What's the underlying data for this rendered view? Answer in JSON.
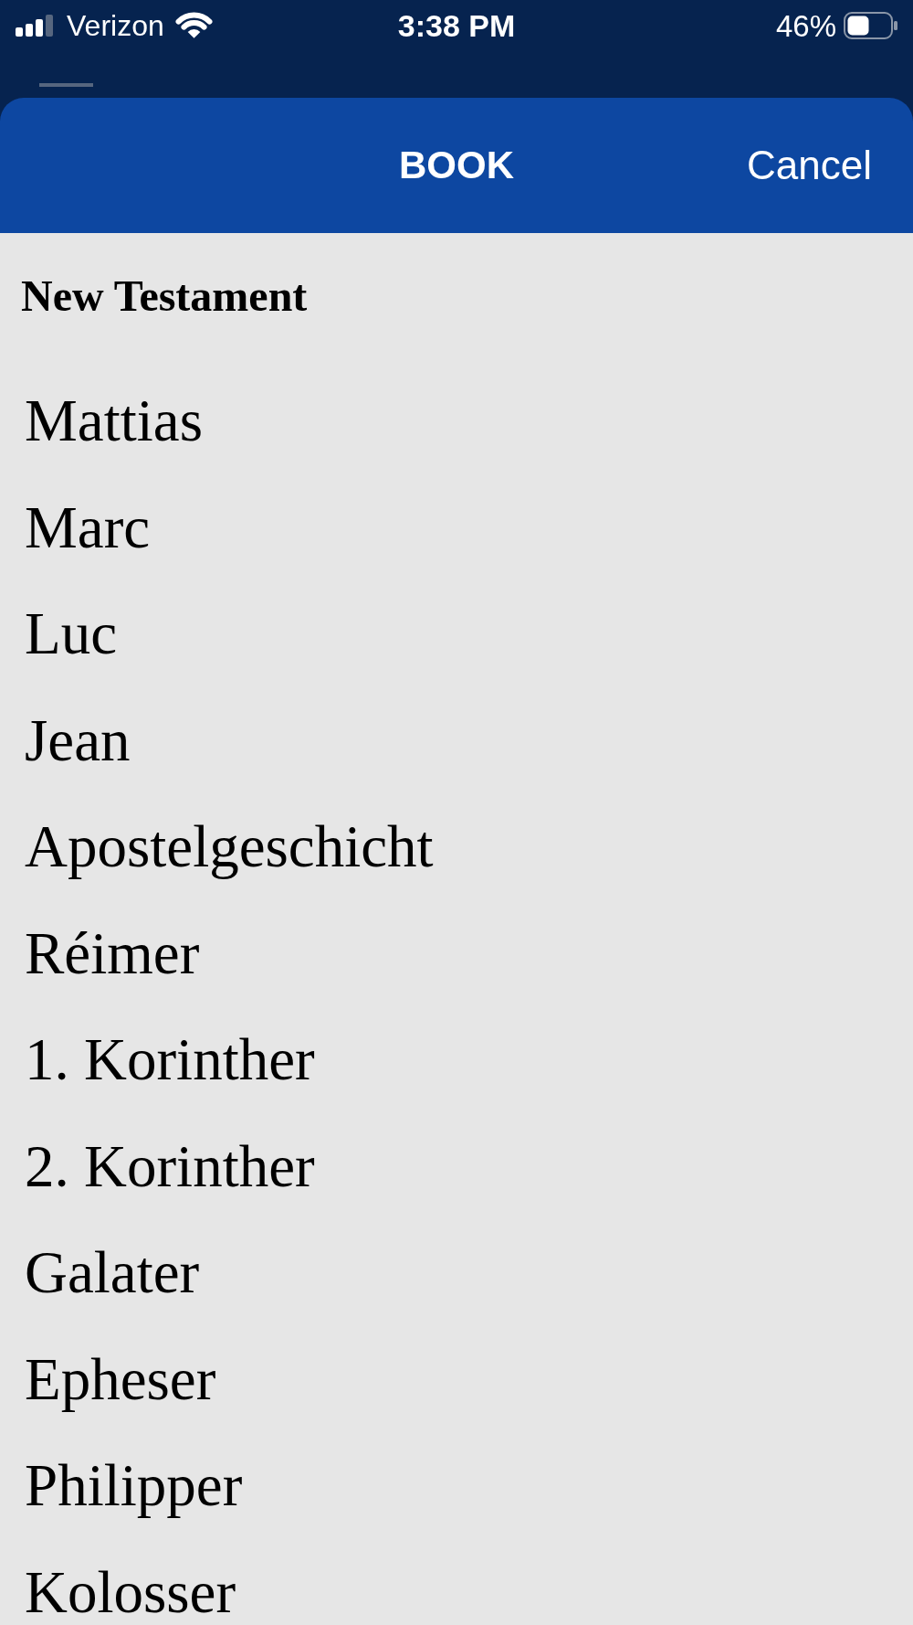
{
  "status_bar": {
    "carrier": "Verizon",
    "time": "3:38 PM",
    "battery": "46%"
  },
  "sheet": {
    "title": "BOOK",
    "cancel": "Cancel"
  },
  "book_list": {
    "section": "New Testament",
    "books": [
      {
        "name": "Mattias",
        "selected": false
      },
      {
        "name": "Marc",
        "selected": false
      },
      {
        "name": "Luc",
        "selected": false
      },
      {
        "name": "Jean",
        "selected": false
      },
      {
        "name": "Apostelgeschicht",
        "selected": false
      },
      {
        "name": "Réimer",
        "selected": false
      },
      {
        "name": "1. Korinther",
        "selected": false
      },
      {
        "name": "2. Korinther",
        "selected": false
      },
      {
        "name": "Galater",
        "selected": false
      },
      {
        "name": "Epheser",
        "selected": false
      },
      {
        "name": "Philipper",
        "selected": false
      },
      {
        "name": "Kolosser",
        "selected": false
      }
    ]
  }
}
